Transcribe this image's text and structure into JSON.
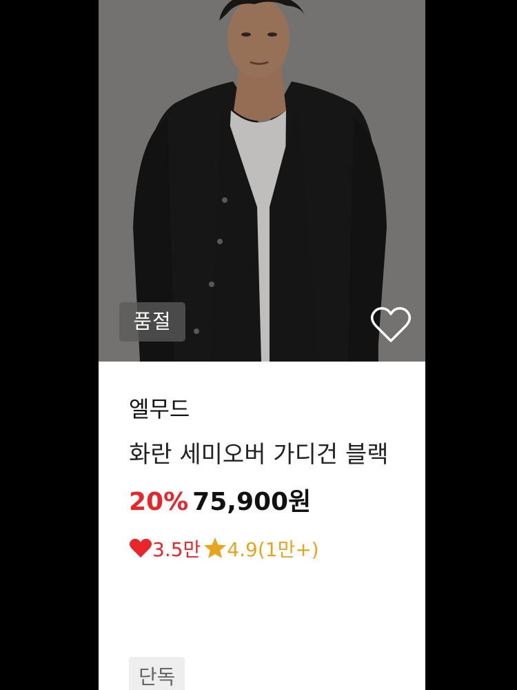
{
  "product": {
    "soldout_label": "품절",
    "brand": "엘무드",
    "title": "화란 세미오버 가디건 블랙",
    "discount": "20%",
    "price": "75,900원",
    "likes": "3.5만",
    "rating": "4.9(1만+)",
    "badge": "단독"
  },
  "icons": {
    "wishlist": "heart-outline-icon",
    "likes": "heart-filled-icon",
    "rating": "star-icon"
  },
  "colors": {
    "discount": "#e8262a",
    "rating": "#e7a51f",
    "background": "#000000"
  }
}
